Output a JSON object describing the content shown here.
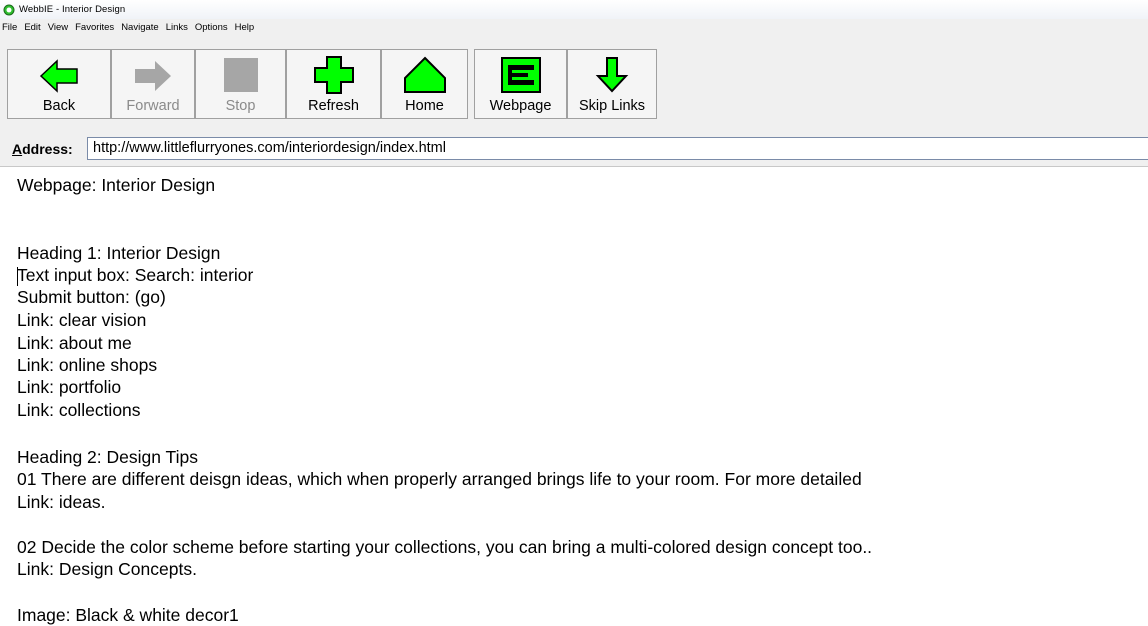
{
  "window": {
    "title": "WebbIE - Interior Design"
  },
  "menu": [
    "File",
    "Edit",
    "View",
    "Favorites",
    "Navigate",
    "Links",
    "Options",
    "Help"
  ],
  "toolbar": {
    "back": {
      "label": "Back",
      "icon": "back-arrow-icon"
    },
    "forward": {
      "label": "Forward",
      "icon": "forward-arrow-icon",
      "disabled": true
    },
    "stop": {
      "label": "Stop",
      "icon": "stop-square-icon",
      "disabled": true
    },
    "refresh": {
      "label": "Refresh",
      "icon": "refresh-cross-icon"
    },
    "home": {
      "label": "Home",
      "icon": "home-icon"
    },
    "webpage": {
      "label": "Webpage",
      "icon": "webpage-icon"
    },
    "skip_links": {
      "label": "Skip Links",
      "icon": "skip-links-arrow-icon"
    }
  },
  "address": {
    "label": "Address:",
    "url": "http://www.littleflurryones.com/interiordesign/index.html"
  },
  "content": {
    "lines": [
      "Webpage: Interior Design",
      "Heading 1: Interior Design",
      "Text input box: Search: interior",
      "Submit button: (go)",
      "Link: clear vision",
      "Link: about me",
      "Link: online shops",
      "Link: portfolio",
      "Link: collections",
      "Heading 2: Design Tips",
      "01 There are different deisgn ideas, which when properly arranged brings life to your room. For more detailed",
      "Link: ideas.",
      "02 Decide the color scheme before starting your collections, you can bring a multi-colored design concept too..",
      "Link: Design Concepts.",
      "Image: Black & white decor1"
    ]
  },
  "colors": {
    "icon_green": "#00ff00",
    "icon_disabled": "#a6a6a6",
    "chrome_bg": "#f0f0f0"
  }
}
